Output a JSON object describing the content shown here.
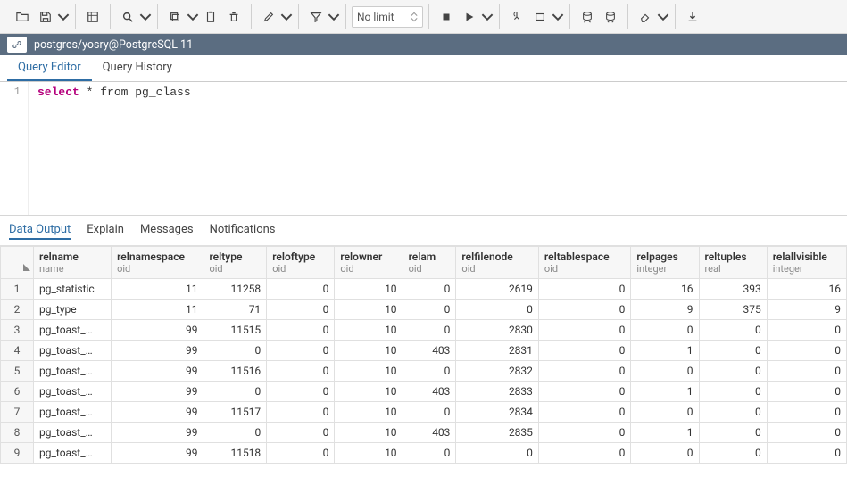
{
  "connection": "postgres/yosry@PostgreSQL 11",
  "limit_label": "No limit",
  "tabs": [
    {
      "label": "Query Editor",
      "active": true
    },
    {
      "label": "Query History",
      "active": false
    }
  ],
  "line_no": "1",
  "sql": {
    "keyword": "select",
    "rest": " * from pg_class"
  },
  "result_tabs": [
    {
      "label": "Data Output",
      "active": true
    },
    {
      "label": "Explain",
      "active": false
    },
    {
      "label": "Messages",
      "active": false
    },
    {
      "label": "Notifications",
      "active": false
    }
  ],
  "columns": [
    {
      "name": "relname",
      "type": "name",
      "cls": "c-rel",
      "numeric": false
    },
    {
      "name": "relnamespace",
      "type": "oid",
      "cls": "c-ns",
      "numeric": true
    },
    {
      "name": "reltype",
      "type": "oid",
      "cls": "c-type",
      "numeric": true
    },
    {
      "name": "reloftype",
      "type": "oid",
      "cls": "c-oft",
      "numeric": true
    },
    {
      "name": "relowner",
      "type": "oid",
      "cls": "c-own",
      "numeric": true
    },
    {
      "name": "relam",
      "type": "oid",
      "cls": "c-am",
      "numeric": true
    },
    {
      "name": "relfilenode",
      "type": "oid",
      "cls": "c-fn",
      "numeric": true
    },
    {
      "name": "reltablespace",
      "type": "oid",
      "cls": "c-ts",
      "numeric": true
    },
    {
      "name": "relpages",
      "type": "integer",
      "cls": "c-pg",
      "numeric": true
    },
    {
      "name": "reltuples",
      "type": "real",
      "cls": "c-tup",
      "numeric": true
    },
    {
      "name": "relallvisible",
      "type": "integer",
      "cls": "c-vis",
      "numeric": true
    }
  ],
  "rows": [
    [
      "pg_statistic",
      11,
      11258,
      0,
      10,
      0,
      2619,
      0,
      16,
      393,
      16
    ],
    [
      "pg_type",
      11,
      71,
      0,
      10,
      0,
      0,
      0,
      9,
      375,
      9
    ],
    [
      "pg_toast_…",
      99,
      11515,
      0,
      10,
      0,
      2830,
      0,
      0,
      0,
      0
    ],
    [
      "pg_toast_…",
      99,
      0,
      0,
      10,
      403,
      2831,
      0,
      1,
      0,
      0
    ],
    [
      "pg_toast_…",
      99,
      11516,
      0,
      10,
      0,
      2832,
      0,
      0,
      0,
      0
    ],
    [
      "pg_toast_…",
      99,
      0,
      0,
      10,
      403,
      2833,
      0,
      1,
      0,
      0
    ],
    [
      "pg_toast_…",
      99,
      11517,
      0,
      10,
      0,
      2834,
      0,
      0,
      0,
      0
    ],
    [
      "pg_toast_…",
      99,
      0,
      0,
      10,
      403,
      2835,
      0,
      1,
      0,
      0
    ],
    [
      "pg_toast_…",
      99,
      11518,
      0,
      10,
      0,
      0,
      0,
      0,
      0,
      0
    ]
  ]
}
